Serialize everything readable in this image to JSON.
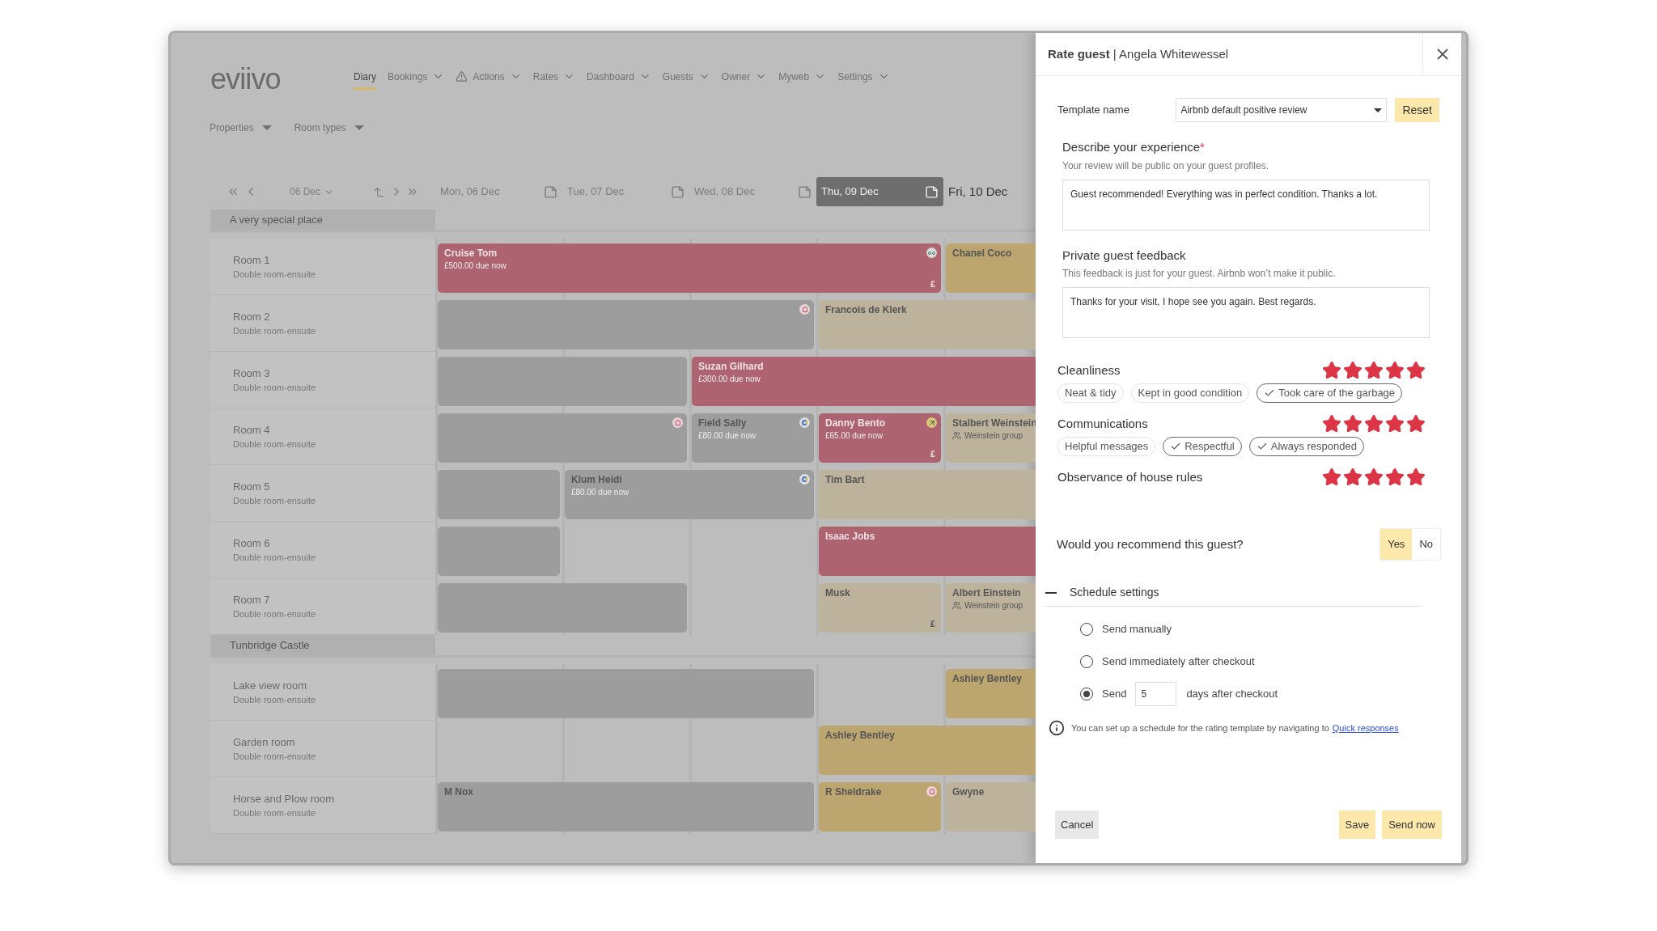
{
  "app": {
    "logo": "eviivo",
    "nav": [
      {
        "label": "Diary",
        "selected": true,
        "dropdown": false,
        "alert": false
      },
      {
        "label": "Bookings",
        "selected": false,
        "dropdown": true,
        "alert": false
      },
      {
        "label": "Actions",
        "selected": false,
        "dropdown": true,
        "alert": true
      },
      {
        "label": "Rates",
        "selected": false,
        "dropdown": true,
        "alert": false
      },
      {
        "label": "Dashboard",
        "selected": false,
        "dropdown": true,
        "alert": false
      },
      {
        "label": "Guests",
        "selected": false,
        "dropdown": true,
        "alert": false
      },
      {
        "label": "Owner",
        "selected": false,
        "dropdown": true,
        "alert": false
      },
      {
        "label": "Myweb",
        "selected": false,
        "dropdown": true,
        "alert": false
      },
      {
        "label": "Settings",
        "selected": false,
        "dropdown": true,
        "alert": false
      }
    ],
    "filters": [
      "Properties",
      "Room types"
    ],
    "date_picker": "06 Dec",
    "days": [
      {
        "label": "Mon, 06 Dec",
        "selected": false,
        "past": true
      },
      {
        "label": "Tue, 07 Dec",
        "selected": false,
        "past": true
      },
      {
        "label": "Wed, 08 Dec",
        "selected": false,
        "past": true
      },
      {
        "label": "Thu, 09 Dec",
        "selected": true,
        "past": false
      },
      {
        "label": "Fri, 10 Dec",
        "selected": false,
        "past": false
      }
    ],
    "properties": [
      {
        "name": "A very special place",
        "rooms": [
          {
            "name": "Room 1",
            "type": "Double room-ensuite",
            "bookings": [
              {
                "color": "#ad6370",
                "name": "Cruise Tom",
                "amount": "£500.00 due now",
                "currency": "£"
              },
              {
                "color": "#bca56e",
                "name": "Chanel Coco"
              }
            ]
          },
          {
            "name": "Room 2",
            "type": "Double room-ensuite",
            "bookings": [
              {
                "color": "#9d9d9d"
              },
              {
                "color": "#bdb29b",
                "name": "Francois de Klerk"
              }
            ]
          },
          {
            "name": "Room 3",
            "type": "Double room-ensuite",
            "bookings": [
              {
                "color": "#9d9d9d"
              },
              {
                "color": "#ad6370",
                "name": "Suzan Gilhard",
                "amount": "£300.00 due now"
              }
            ]
          },
          {
            "name": "Room 4",
            "type": "Double room-ensuite",
            "bookings": [
              {
                "color": "#9d9d9d"
              },
              {
                "color": "#9d9d9d",
                "name": "Field Sally",
                "amount": "£80.00 due now"
              },
              {
                "color": "#ad6370",
                "name": "Danny Bento",
                "amount": "£65.00 due now",
                "currency": "£"
              },
              {
                "color": "#bdb29b",
                "name": "Stalbert Weinstein",
                "group": "Weinstein group"
              }
            ]
          },
          {
            "name": "Room 5",
            "type": "Double room-ensuite",
            "bookings": [
              {
                "color": "#9d9d9d"
              },
              {
                "color": "#9d9d9d",
                "name": "Klum Heidi",
                "amount": "£80.00 due now"
              },
              {
                "color": "#bdb29b",
                "name": "Tim Bart"
              }
            ]
          },
          {
            "name": "Room 6",
            "type": "Double room-ensuite",
            "bookings": [
              {
                "color": "#9d9d9d"
              },
              {
                "color": "#ad6370",
                "name": "Isaac Jobs"
              }
            ]
          },
          {
            "name": "Room 7",
            "type": "Double room-ensuite",
            "bookings": [
              {
                "color": "#9d9d9d"
              },
              {
                "color": "#bdb29b",
                "name": "Musk",
                "currency": "£"
              },
              {
                "color": "#bdb29b",
                "name": "Albert Einstein",
                "group": "Weinstein group"
              }
            ]
          }
        ]
      },
      {
        "name": "Tunbridge Castle",
        "rooms": [
          {
            "name": "Lake view room",
            "type": "Double room-ensuite",
            "bookings": [
              {
                "color": "#9d9d9d"
              },
              {
                "color": "#bca56e",
                "name": "Ashley Bentley"
              }
            ]
          },
          {
            "name": "Garden room",
            "type": "Double room-ensuite",
            "bookings": [
              {
                "color": "#bca56e",
                "name": "Ashley Bentley"
              }
            ]
          },
          {
            "name": "Horse and Plow room",
            "type": "Double room-ensuite",
            "bookings": [
              {
                "color": "#9d9d9d",
                "name": "M Nox"
              },
              {
                "color": "#bca56e",
                "name": "R Sheldrake"
              },
              {
                "color": "#bdb29b",
                "name": "Gwyne"
              }
            ]
          }
        ]
      }
    ]
  },
  "dialog": {
    "title": "**Rate guest** | Angela Whitewessel",
    "template": {
      "label": "Template name",
      "value": "Airbnb default positive review",
      "reset": "Reset"
    },
    "experience": {
      "heading": "Describe your experience",
      "required": "*",
      "hint": "Your review will be public on your guest profiles.",
      "value": "Guest recommended! Everything was in perfect condition. Thanks a lot."
    },
    "feedback": {
      "heading": "Private guest feedback",
      "hint": "This feedback is just for your guest. Airbnb won’t make it public.",
      "value": "Thanks for your visit, I hope see you again. Best regards."
    },
    "ratings": [
      {
        "label": "Cleanliness",
        "stars": 5,
        "tags": [
          {
            "label": "Neat & tidy",
            "selected": false
          },
          {
            "label": "Kept in good condition",
            "selected": false
          },
          {
            "label": "Took care of the garbage",
            "selected": true
          }
        ]
      },
      {
        "label": "Communications",
        "stars": 5,
        "tags": [
          {
            "label": "Helpful messages",
            "selected": false
          },
          {
            "label": "Respectful",
            "selected": true
          },
          {
            "label": "Always responded",
            "selected": true
          }
        ]
      },
      {
        "label": "Observance of house rules",
        "stars": 5
      }
    ],
    "recommend": {
      "question": "Would you recommend this guest?",
      "options": [
        {
          "label": "Yes",
          "selected": true
        },
        {
          "label": "No",
          "selected": false
        }
      ]
    },
    "schedule": {
      "title": "Schedule settings",
      "expanded": true,
      "options": [
        {
          "kind": "plain",
          "label": "Send manually",
          "selected": false
        },
        {
          "kind": "plain",
          "label": "Send immediately after checkout",
          "selected": false
        },
        {
          "kind": "days",
          "label": "Send",
          "value": "5",
          "suffix": "days after checkout",
          "selected": true
        }
      ],
      "info": "You can set up a schedule for the rating template by navigating to",
      "link": "Quick responses"
    },
    "buttons": {
      "cancel": "Cancel",
      "save": "Save",
      "send": "Send now"
    }
  }
}
